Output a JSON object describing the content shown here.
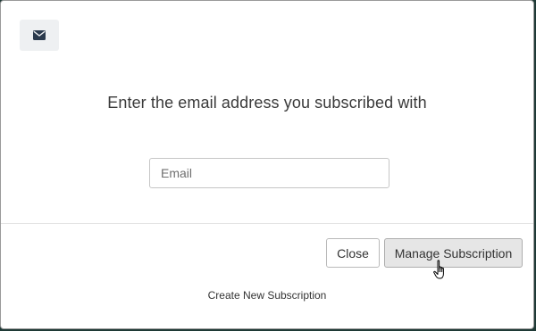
{
  "modal": {
    "heading": "Enter the email address you subscribed with",
    "email_input": {
      "value": "",
      "placeholder": "Email"
    },
    "close_label": "Close",
    "manage_label": "Manage Subscription",
    "create_link": "Create New Subscription",
    "header_icon": "envelope-icon",
    "cursor_icon": "hand-pointer-icon"
  },
  "colors": {
    "modal_background": "#ffffff",
    "icon_box_background": "#eef0f2",
    "icon_color": "#2b3a4d",
    "manage_button_background": "#e6e6e6"
  }
}
